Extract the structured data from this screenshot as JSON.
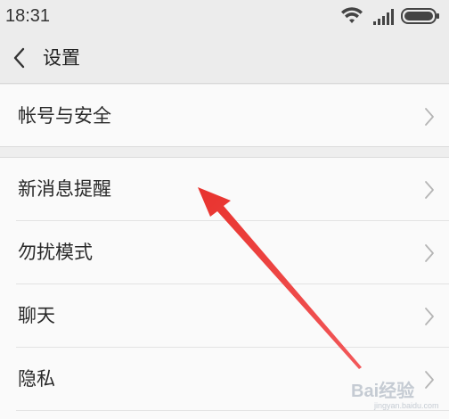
{
  "status_bar": {
    "time": "18:31",
    "icons": [
      "wifi-icon",
      "signal-icon",
      "battery-icon"
    ]
  },
  "header": {
    "back_icon": "chevron-left-icon",
    "title": "设置"
  },
  "settings_groups": [
    {
      "items": [
        {
          "label": "帐号与安全"
        }
      ]
    },
    {
      "items": [
        {
          "label": "新消息提醒"
        },
        {
          "label": "勿扰模式"
        },
        {
          "label": "聊天"
        },
        {
          "label": "隐私"
        }
      ]
    }
  ],
  "annotation": {
    "type": "arrow",
    "color": "#e8332e",
    "points_to": "新消息提醒"
  },
  "watermark": {
    "text": "Bai经验",
    "subtext": "jingyan.baidu.com"
  },
  "colors": {
    "background": "#eeeeee",
    "header": "#ececec",
    "list_bg": "#fafafa",
    "text": "#2a2a2a",
    "chevron": "#b5b5b5"
  }
}
